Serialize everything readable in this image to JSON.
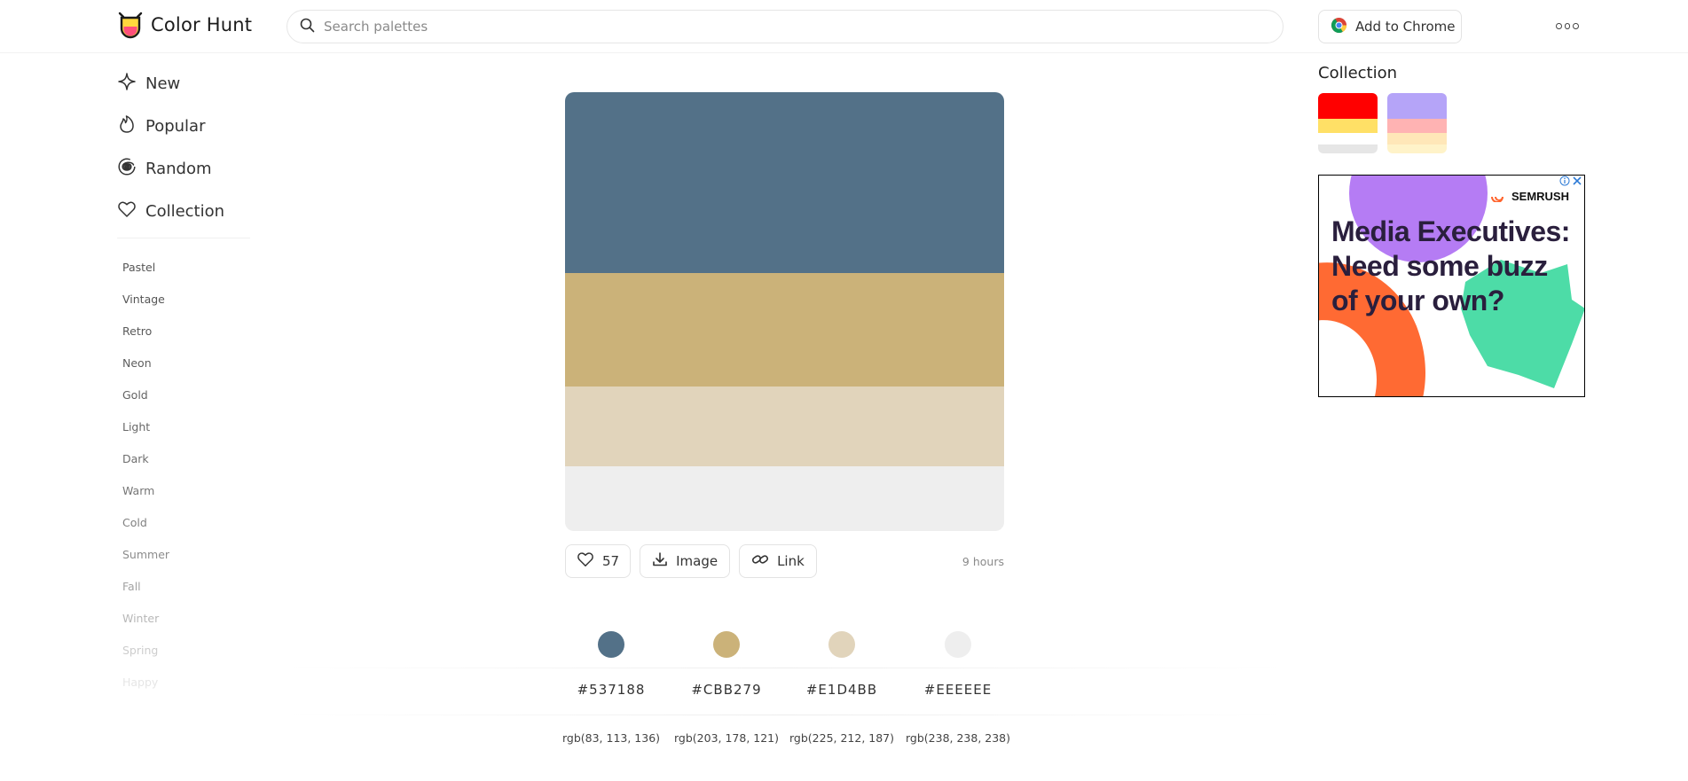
{
  "header": {
    "brand": "Color Hunt",
    "search_placeholder": "Search palettes",
    "chrome_button": "Add to Chrome"
  },
  "sidebar": {
    "nav": [
      {
        "label": "New",
        "icon": "sparkle-icon"
      },
      {
        "label": "Popular",
        "icon": "flame-icon"
      },
      {
        "label": "Random",
        "icon": "spiral-icon"
      },
      {
        "label": "Collection",
        "icon": "heart-icon"
      }
    ],
    "tags": [
      {
        "label": "Pastel",
        "color": "#555555"
      },
      {
        "label": "Vintage",
        "color": "#555555"
      },
      {
        "label": "Retro",
        "color": "#5a5a5a"
      },
      {
        "label": "Neon",
        "color": "#5e5e5e"
      },
      {
        "label": "Gold",
        "color": "#626262"
      },
      {
        "label": "Light",
        "color": "#686868"
      },
      {
        "label": "Dark",
        "color": "#6e6e6e"
      },
      {
        "label": "Warm",
        "color": "#767676"
      },
      {
        "label": "Cold",
        "color": "#808080"
      },
      {
        "label": "Summer",
        "color": "#8c8c8c"
      },
      {
        "label": "Fall",
        "color": "#a2a2a2"
      },
      {
        "label": "Winter",
        "color": "#b8b8b8"
      },
      {
        "label": "Spring",
        "color": "#cdcdcd"
      },
      {
        "label": "Happy",
        "color": "#e6e6e6"
      }
    ]
  },
  "palette": {
    "colors": [
      {
        "hex": "#537188",
        "rgb": "rgb(83, 113, 136)"
      },
      {
        "hex": "#CBB279",
        "rgb": "rgb(203, 178, 121)"
      },
      {
        "hex": "#E1D4BB",
        "rgb": "rgb(225, 212, 187)"
      },
      {
        "hex": "#EEEEEE",
        "rgb": "rgb(238, 238, 238)"
      }
    ],
    "likes": "57",
    "image_label": "Image",
    "link_label": "Link",
    "time": "9 hours"
  },
  "collection": {
    "title": "Collection",
    "palettes": [
      [
        "#ff0000",
        "#ffe066",
        "#ffffff",
        "#e6e6e6"
      ],
      [
        "#b5a4f8",
        "#ffb3b3",
        "#ffe7b8",
        "#fff3c9"
      ]
    ]
  },
  "ad": {
    "brand": "SEMRUSH",
    "headline": "Media Executives: Need some buzz of your own?",
    "colors": {
      "purple": "#b57cf4",
      "orange": "#ff6a33",
      "green": "#4ddca7"
    }
  }
}
